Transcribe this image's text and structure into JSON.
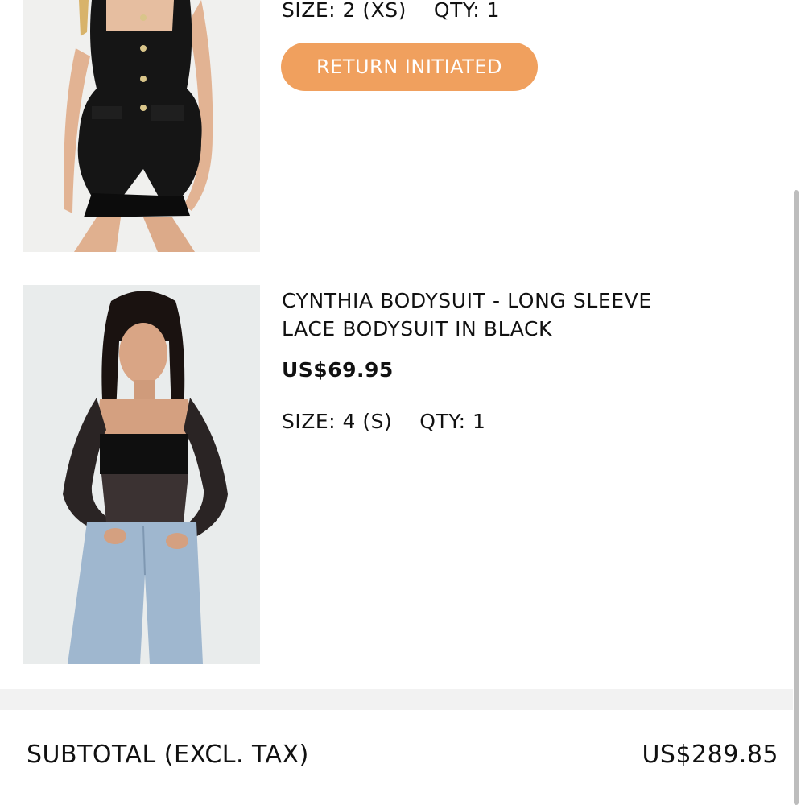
{
  "items": [
    {
      "size": "SIZE: 2 (XS)",
      "qty": "QTY: 1",
      "status": "RETURN INITIATED",
      "image_icon": "product-photo-black-vest-dress"
    },
    {
      "title_line1": "CYNTHIA BODYSUIT - LONG SLEEVE",
      "title_line2": "LACE BODYSUIT IN BLACK",
      "price": "US$69.95",
      "size": "SIZE: 4 (S)",
      "qty": "QTY: 1",
      "image_icon": "product-photo-lace-bodysuit"
    }
  ],
  "summary": {
    "subtotal_label": "SUBTOTAL (EXCL. TAX)",
    "subtotal_value": "US$289.85"
  },
  "colors": {
    "badge": "#f0a05e",
    "divider": "#f2f2f2",
    "scrollbar": "#bdbdbd"
  }
}
